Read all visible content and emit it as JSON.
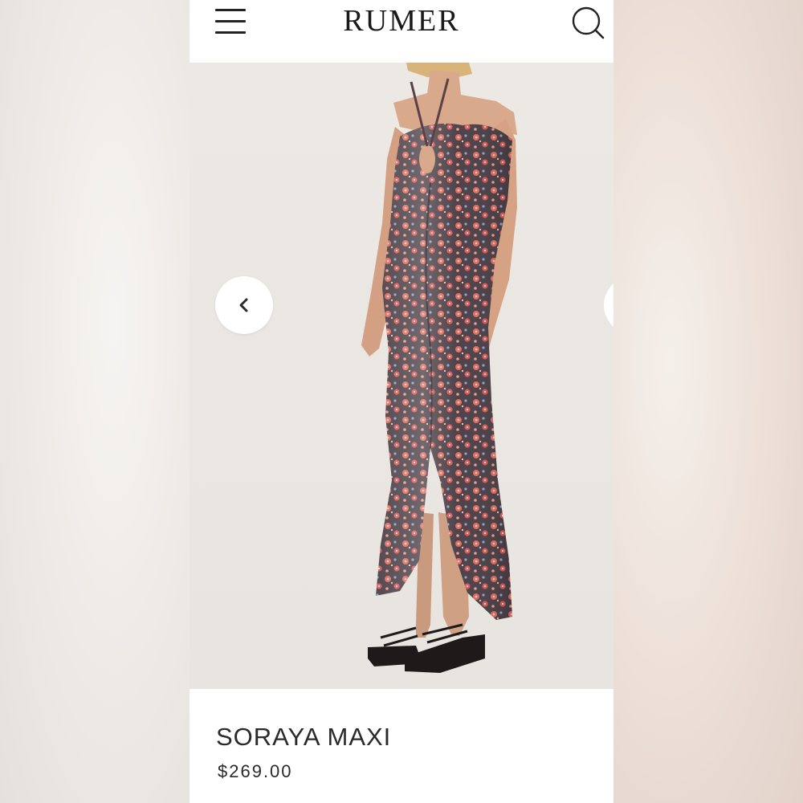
{
  "header": {
    "brand": "RUMER",
    "menu_icon": "hamburger-menu-icon",
    "search_icon": "search-icon"
  },
  "gallery": {
    "prev_icon": "chevron-left-icon",
    "image_description_icon": "product-photo"
  },
  "product": {
    "name": "SORAYA MAXI",
    "price": "$269.00"
  },
  "colors": {
    "background": "#ffffff",
    "text": "#2a2a2a",
    "photo_backdrop": "#eae6e2"
  }
}
